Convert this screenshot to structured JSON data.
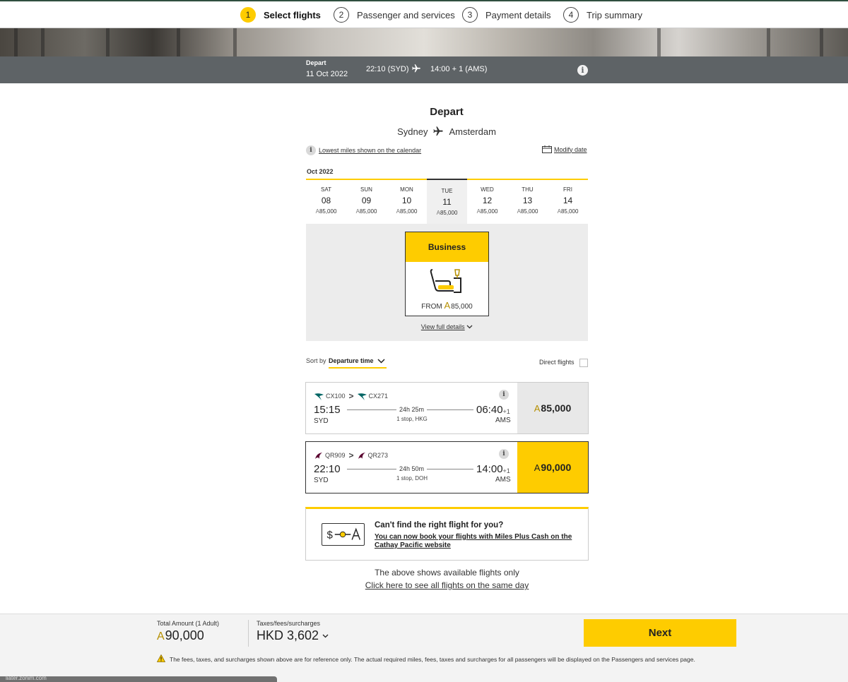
{
  "stepper": {
    "steps": [
      {
        "num": "1",
        "label": "Select flights"
      },
      {
        "num": "2",
        "label": "Passenger and services"
      },
      {
        "num": "3",
        "label": "Payment details"
      },
      {
        "num": "4",
        "label": "Trip summary"
      }
    ],
    "active_step": 1
  },
  "depart_bar": {
    "label": "Depart",
    "date": "11 Oct 2022",
    "departure": "22:10 (SYD)",
    "arrival": "14:00 + 1 (AMS)",
    "info_icon": "i"
  },
  "heading": "Depart",
  "route": {
    "from": "Sydney",
    "to": "Amsterdam"
  },
  "lowest_miles_note": "Lowest miles shown on the calendar",
  "info_glyph": "i",
  "modify_date": "Modify date",
  "calendar": {
    "month": "Oct 2022",
    "days": [
      {
        "dow": "SAT",
        "date": "08",
        "miles": "85,000"
      },
      {
        "dow": "SUN",
        "date": "09",
        "miles": "85,000"
      },
      {
        "dow": "MON",
        "date": "10",
        "miles": "85,000"
      },
      {
        "dow": "TUE",
        "date": "11",
        "miles": "85,000",
        "selected": true
      },
      {
        "dow": "WED",
        "date": "12",
        "miles": "85,000"
      },
      {
        "dow": "THU",
        "date": "13",
        "miles": "85,000"
      },
      {
        "dow": "FRI",
        "date": "14",
        "miles": "85,000"
      }
    ]
  },
  "miles_symbol": "A",
  "cabin": {
    "name": "Business",
    "from_label": "FROM",
    "from_miles": "85,000"
  },
  "view_full_details": "View full details",
  "sort": {
    "label": "Sort by",
    "value": "Departure time"
  },
  "direct_flights": {
    "label": "Direct flights",
    "checked": false
  },
  "flights": [
    {
      "seg1": "CX100",
      "seg2": "CX271",
      "sep": ">",
      "dep_time": "15:15",
      "dep_code": "SYD",
      "duration": "24h 25m",
      "stops": "1 stop, HKG",
      "arr_time": "06:40",
      "arr_plus": "+1",
      "arr_code": "AMS",
      "price": "85,000",
      "selected": false
    },
    {
      "seg1": "QR909",
      "seg2": "QR273",
      "sep": ">",
      "dep_time": "22:10",
      "dep_code": "SYD",
      "duration": "24h 50m",
      "stops": "1 stop, DOH",
      "arr_time": "14:00",
      "arr_plus": "+1",
      "arr_code": "AMS",
      "price": "90,000",
      "selected": true
    }
  ],
  "promo": {
    "title": "Can't find the right flight for you?",
    "link": "You can now book your flights with Miles Plus Cash on the Cathay Pacific website"
  },
  "available_note": "The above shows available flights only",
  "all_flights_link": "Click here to see all flights on the same day",
  "footer": {
    "total_label": "Total Amount (1 Adult)",
    "total_value": "90,000",
    "taxes_label": "Taxes/fees/surcharges",
    "taxes_value": "HKD 3,602",
    "next_label": "Next",
    "note": "The fees, taxes, and surcharges shown above are for reference only. The actual required miles, fees, taxes and surcharges for all passengers will be displayed on the Passengers and services page.",
    "status_url": "liater.zonim.com"
  },
  "colors": {
    "accent": "#fecc00",
    "bar": "#5e6366",
    "cx_green": "#006564",
    "qr_maroon": "#5c0632"
  }
}
